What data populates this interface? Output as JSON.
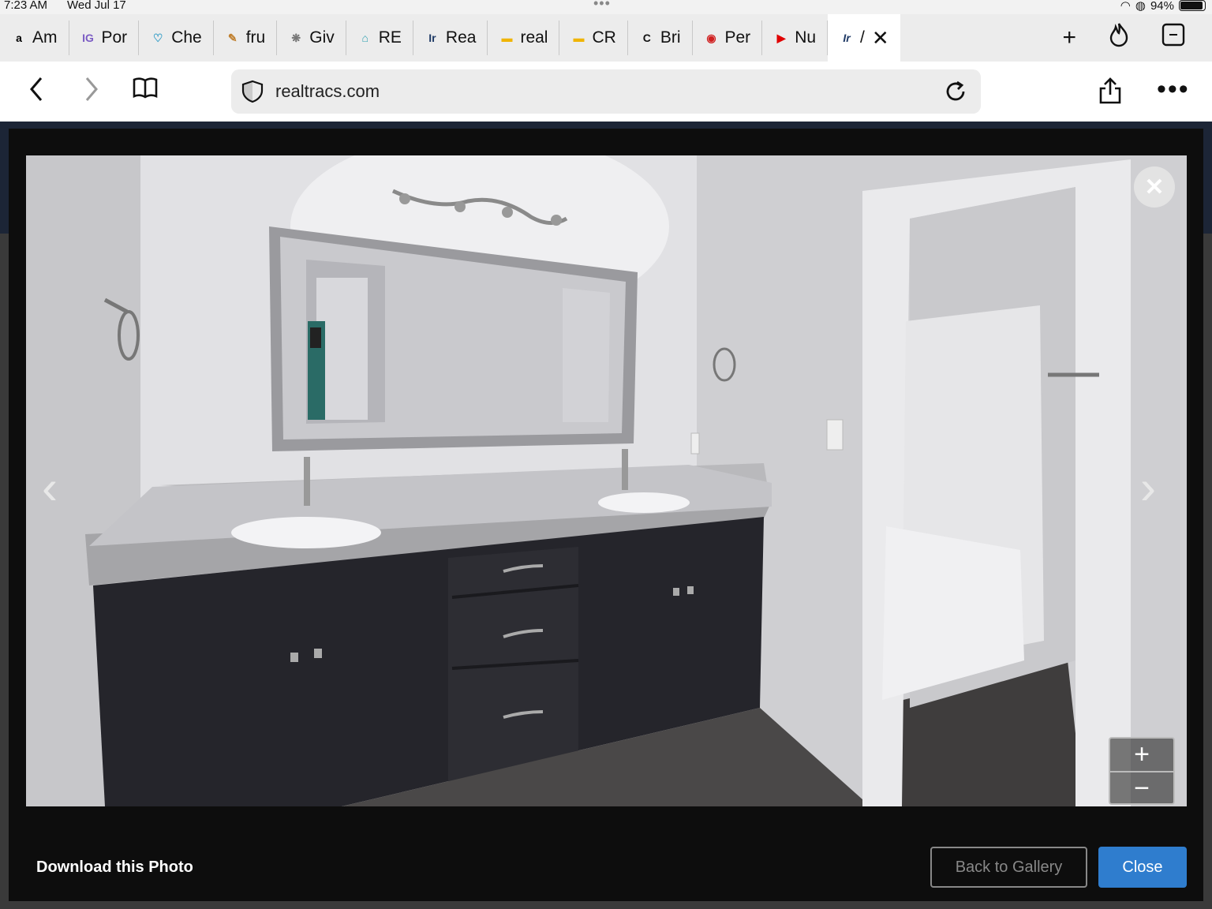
{
  "status": {
    "time": "7:23 AM",
    "date": "Wed Jul 17",
    "battery": "94%",
    "battery_level": 0.94,
    "dots": "•••"
  },
  "tabs": [
    {
      "icon": "amazon-icon",
      "glyph": "a",
      "color": "#000000",
      "label": "Am"
    },
    {
      "icon": "portal-icon",
      "glyph": "IG",
      "color": "#7b5cc4",
      "label": "Por"
    },
    {
      "icon": "heart-icon",
      "glyph": "♡",
      "color": "#3aa0c8",
      "label": "Che"
    },
    {
      "icon": "pin-icon",
      "glyph": "✎",
      "color": "#c08030",
      "label": "fru"
    },
    {
      "icon": "sparkle-icon",
      "glyph": "❋",
      "color": "#777777",
      "label": "Giv"
    },
    {
      "icon": "home-icon",
      "glyph": "⌂",
      "color": "#2a9fb0",
      "label": "RE"
    },
    {
      "icon": "realtracs-icon",
      "glyph": "Ir",
      "color": "#1f3a66",
      "label": "Rea"
    },
    {
      "icon": "realtor-icon",
      "glyph": "▬",
      "color": "#f0b400",
      "label": "real"
    },
    {
      "icon": "cr-icon",
      "glyph": "▬",
      "color": "#f0b400",
      "label": "CR"
    },
    {
      "icon": "c-icon",
      "glyph": "C",
      "color": "#111111",
      "label": "Bri"
    },
    {
      "icon": "target-icon",
      "glyph": "◉",
      "color": "#d02020",
      "label": "Per"
    },
    {
      "icon": "youtube-icon",
      "glyph": "▶",
      "color": "#e00000",
      "label": "Nu"
    }
  ],
  "active_tab": {
    "glyph": "Ir",
    "label": "/",
    "close": "✕"
  },
  "tab_actions": {
    "new_tab": "+",
    "fire": "🔥",
    "tabs": "⊟"
  },
  "nav": {
    "back": "‹",
    "forward": "›",
    "url": "realtracs.com"
  },
  "modal": {
    "download": "Download this Photo",
    "back_to_gallery": "Back to Gallery",
    "close": "Close",
    "close_x": "✕",
    "prev": "‹",
    "next": "›",
    "zoom_in": "+",
    "zoom_out": "−"
  }
}
